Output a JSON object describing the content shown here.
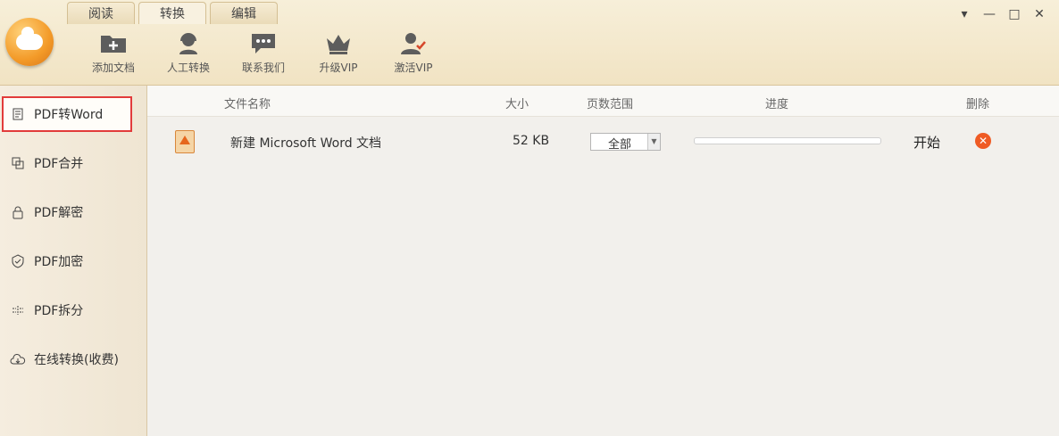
{
  "tabs": [
    {
      "label": "阅读"
    },
    {
      "label": "转换"
    },
    {
      "label": "编辑"
    }
  ],
  "toolbar": {
    "items": [
      {
        "label": "添加文档",
        "icon": "add-folder-icon"
      },
      {
        "label": "人工转换",
        "icon": "headset-agent-icon"
      },
      {
        "label": "联系我们",
        "icon": "chat-bubble-icon"
      },
      {
        "label": "升级VIP",
        "icon": "crown-icon"
      },
      {
        "label": "激活VIP",
        "icon": "user-check-icon"
      }
    ]
  },
  "window_controls": {
    "menu": "▾",
    "minimize": "—",
    "maximize": "□",
    "close": "✕"
  },
  "sidebar": {
    "items": [
      {
        "label": "PDF转Word",
        "icon": "pdf-word-icon",
        "active": true
      },
      {
        "label": "PDF合并",
        "icon": "merge-icon"
      },
      {
        "label": "PDF解密",
        "icon": "lock-icon"
      },
      {
        "label": "PDF加密",
        "icon": "shield-icon"
      },
      {
        "label": "PDF拆分",
        "icon": "split-icon"
      },
      {
        "label": "在线转换(收费)",
        "icon": "cloud-icon"
      }
    ]
  },
  "table": {
    "headers": {
      "name": "文件名称",
      "size": "大小",
      "range": "页数范围",
      "progress": "进度",
      "delete": "删除"
    },
    "rows": [
      {
        "name": "新建 Microsoft Word 文档",
        "size": "52 KB",
        "range": "全部",
        "progress": 0,
        "action": "开始"
      }
    ]
  },
  "colors": {
    "accent": "#f39a28",
    "highlight_border": "#e23b3b",
    "delete_button": "#ef5b24"
  }
}
